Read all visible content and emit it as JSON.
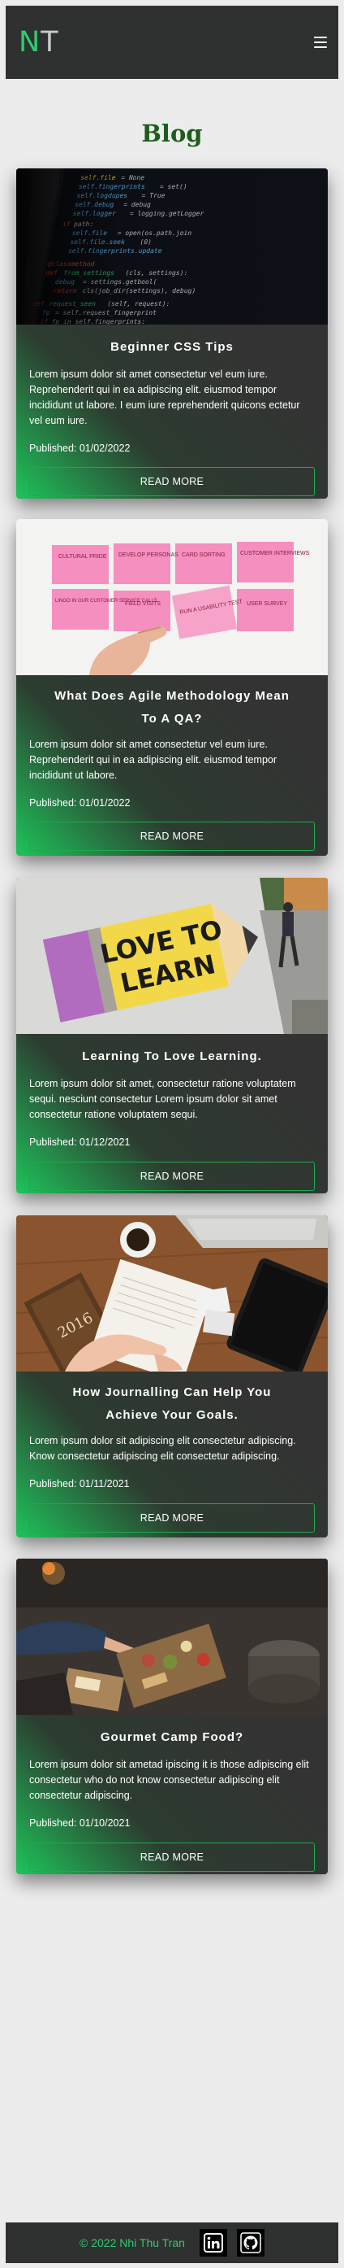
{
  "header": {
    "logo_first": "N",
    "logo_second": "T"
  },
  "page_title": "Blog",
  "read_more_label": "READ MORE",
  "posts": [
    {
      "title": "Beginner CSS Tips",
      "text": "Lorem ipsum dolor sit amet consectetur vel eum iure. Reprehenderit qui in ea adipiscing elit. eiusmod tempor incididunt ut labore. I eum iure reprehenderit quicons ectetur vel eum iure.",
      "date": "Published: 01/02/2022",
      "image": "code-screen"
    },
    {
      "title": "What Does Agile Methodology Mean To A QA?",
      "text": "Lorem ipsum dolor sit amet consectetur vel eum iure. Reprehenderit qui in ea adipiscing elit. eiusmod tempor incididunt ut labore.",
      "date": "Published: 01/01/2022",
      "image": "sticky-notes",
      "notes": [
        "CULTURAL PRIDE",
        "DEVELOP PERSONAS",
        "CARD SORTING",
        "CUSTOMER INTERVIEWS",
        "LINGO IN OUR CUSTOMER SERVICE CALLS",
        "FIELD VISITS",
        "RUN A USABILITY TEST",
        "USER SURVEY"
      ]
    },
    {
      "title": "Learning To Love Learning.",
      "text": "Lorem ipsum dolor sit amet, consectetur ratione voluptatem sequi. nesciunt consectetur Lorem ipsum dolor sit amet consectetur ratione voluptatem sequi.",
      "date": "Published: 01/12/2021",
      "image": "love-to-learn",
      "pencil_line1": "LOVE TO",
      "pencil_line2": "LEARN"
    },
    {
      "title": "How Journalling Can Help You Achieve Your Goals.",
      "text": "Lorem ipsum dolor sit adipiscing elit consectetur adipiscing. Know consectetur adipiscing elit consectetur adipiscing.",
      "date": "Published: 01/11/2021",
      "image": "journal-desk",
      "journal_label": "2016"
    },
    {
      "title": "Gourmet Camp Food?",
      "text": "Lorem ipsum dolor sit ametad ipiscing it is those adipiscing elit consectetur who do not know consectetur adipiscing elit consectetur adipiscing.",
      "date": "Published: 01/10/2021",
      "image": "camp-food"
    }
  ],
  "footer": {
    "copyright": "© 2022 Nhi Thu Tran",
    "icons": [
      "linkedin-icon",
      "github-icon"
    ]
  },
  "colors": {
    "accent": "#2ecc71",
    "title": "#1d5e1d",
    "card_dark": "#333333",
    "card_green": "#1ec45a",
    "background": "#ececec"
  }
}
